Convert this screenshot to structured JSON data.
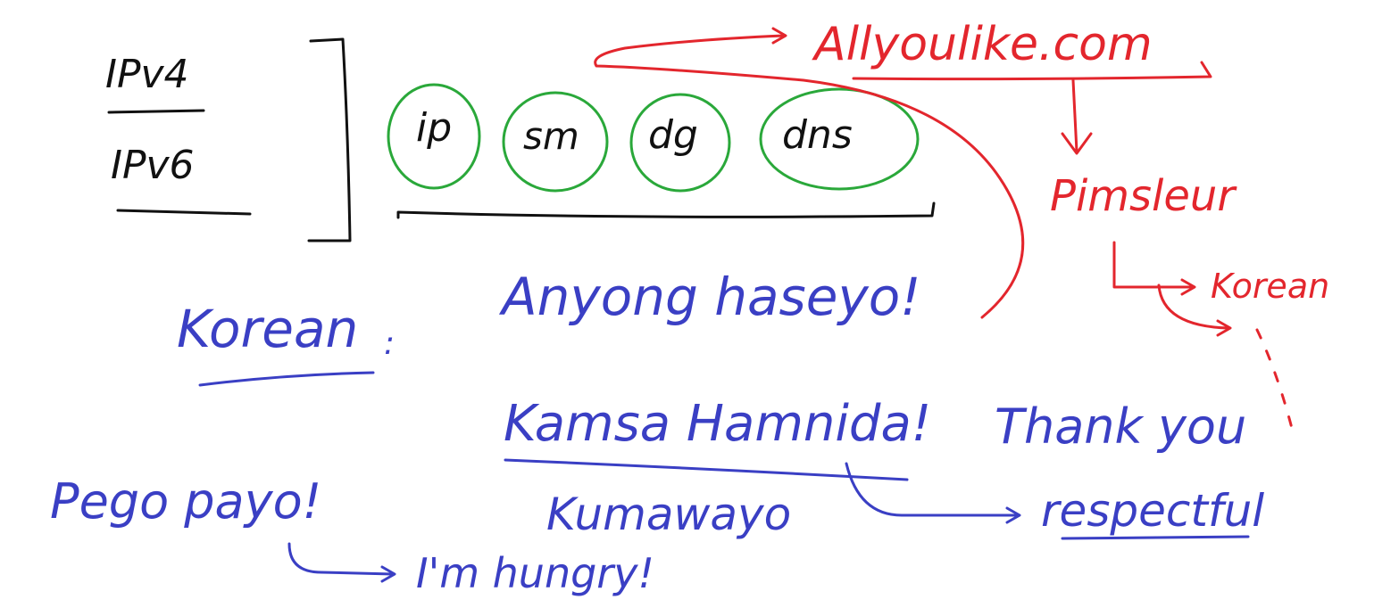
{
  "colors": {
    "ink_black": "#111111",
    "ink_green": "#2aa83a",
    "ink_blue": "#3a3fc4",
    "ink_red": "#e3262d",
    "background": "#ffffff"
  },
  "network": {
    "protocols": [
      "IPv4",
      "IPv6"
    ],
    "settings": [
      "ip",
      "sm",
      "dg",
      "dns"
    ]
  },
  "resources": {
    "website": "Allyoulike.com",
    "course": "Pimsleur",
    "course_language": "Korean"
  },
  "korean": {
    "label": "Korean",
    "colon": ":",
    "greeting": "Anyong haseyo!",
    "thanks_formal": "Kamsa Hamnida!",
    "thanks_translation": "Thank you",
    "thanks_note": "respectful",
    "thanks_casual": "Kumawayo",
    "hungry_phrase": "Pego payo!",
    "hungry_translation": "I'm hungry!"
  }
}
